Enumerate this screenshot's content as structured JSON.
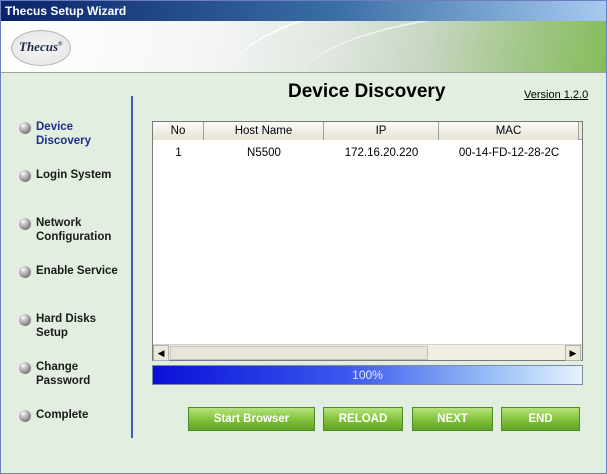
{
  "window": {
    "title": "Thecus Setup Wizard"
  },
  "banner": {
    "logo_text": "Thecus",
    "logo_mark": "®"
  },
  "page": {
    "heading": "Device Discovery",
    "version": "Version 1.2.0"
  },
  "steps": [
    {
      "label": "Device Discovery",
      "active": true
    },
    {
      "label": "Login System",
      "active": false
    },
    {
      "label": "Network Configuration",
      "active": false
    },
    {
      "label": "Enable Service",
      "active": false
    },
    {
      "label": "Hard Disks Setup",
      "active": false
    },
    {
      "label": "Change Password",
      "active": false
    },
    {
      "label": "Complete",
      "active": false
    }
  ],
  "table": {
    "columns": [
      "No",
      "Host Name",
      "IP",
      "MAC"
    ],
    "rows": [
      [
        "1",
        "N5500",
        "172.16.20.220",
        "00-14-FD-12-28-2C"
      ]
    ]
  },
  "scrollbar": {
    "left_arrow": "◀",
    "right_arrow": "▶"
  },
  "progress": {
    "value": 100,
    "label": "100%"
  },
  "buttons": {
    "start_browser": "Start Browser",
    "reload": "RELOAD",
    "next": "NEXT",
    "end": "END"
  }
}
